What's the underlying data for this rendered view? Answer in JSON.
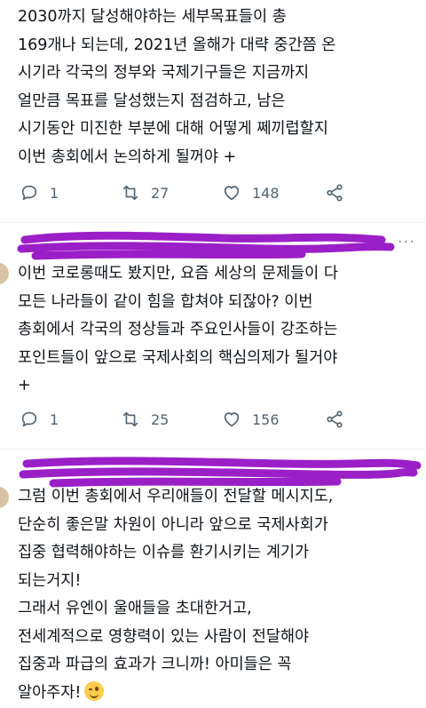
{
  "tweets": [
    {
      "lines": [
        "2030까지 달성해야하는 세부목표들이 총",
        "169개나 되는데, 2021년 올해가 대략 중간쯤 온",
        "시기라 각국의 정부와 국제기구들은 지금까지",
        "얼만큼 목표를 달성했는지 점검하고, 남은",
        "시기동안 미진한 부분에 대해 어떻게 쩨끼럽할지",
        "이번 총회에서 논의하게 될꺼야 +"
      ],
      "replies": "1",
      "retweets": "27",
      "likes": "148"
    },
    {
      "more": "···",
      "lines": [
        "이번 코로롱때도 봤지만, 요즘 세상의 문제들이 다",
        "모든 나라들이 같이 힘을 합쳐야 되잖아? 이번",
        "총회에서 각국의 정상들과 주요인사들이 강조하는",
        "포인트들이 앞으로 국제사회의 핵심의제가 될거야",
        "+"
      ],
      "replies": "1",
      "retweets": "25",
      "likes": "156"
    },
    {
      "lines": [
        "그럼 이번 총회에서 우리애들이 전달할 메시지도,",
        "단순히 좋은말 차원이 아니라 앞으로 국제사회가",
        "집중 협력해야하는 이슈를 환기시키는 계기가",
        "되는거지!",
        "그래서 유엔이 울애들을 초대한거고,",
        "전세계적으로 영향력이 있는 사람이 전달해야",
        "집중과 파급의 효과가 크니까! 아미들은 꼭",
        "알아주자!"
      ],
      "emoji": "winking-face"
    }
  ],
  "colors": {
    "scribble": "#9b1fc7",
    "icon": "#536471"
  }
}
